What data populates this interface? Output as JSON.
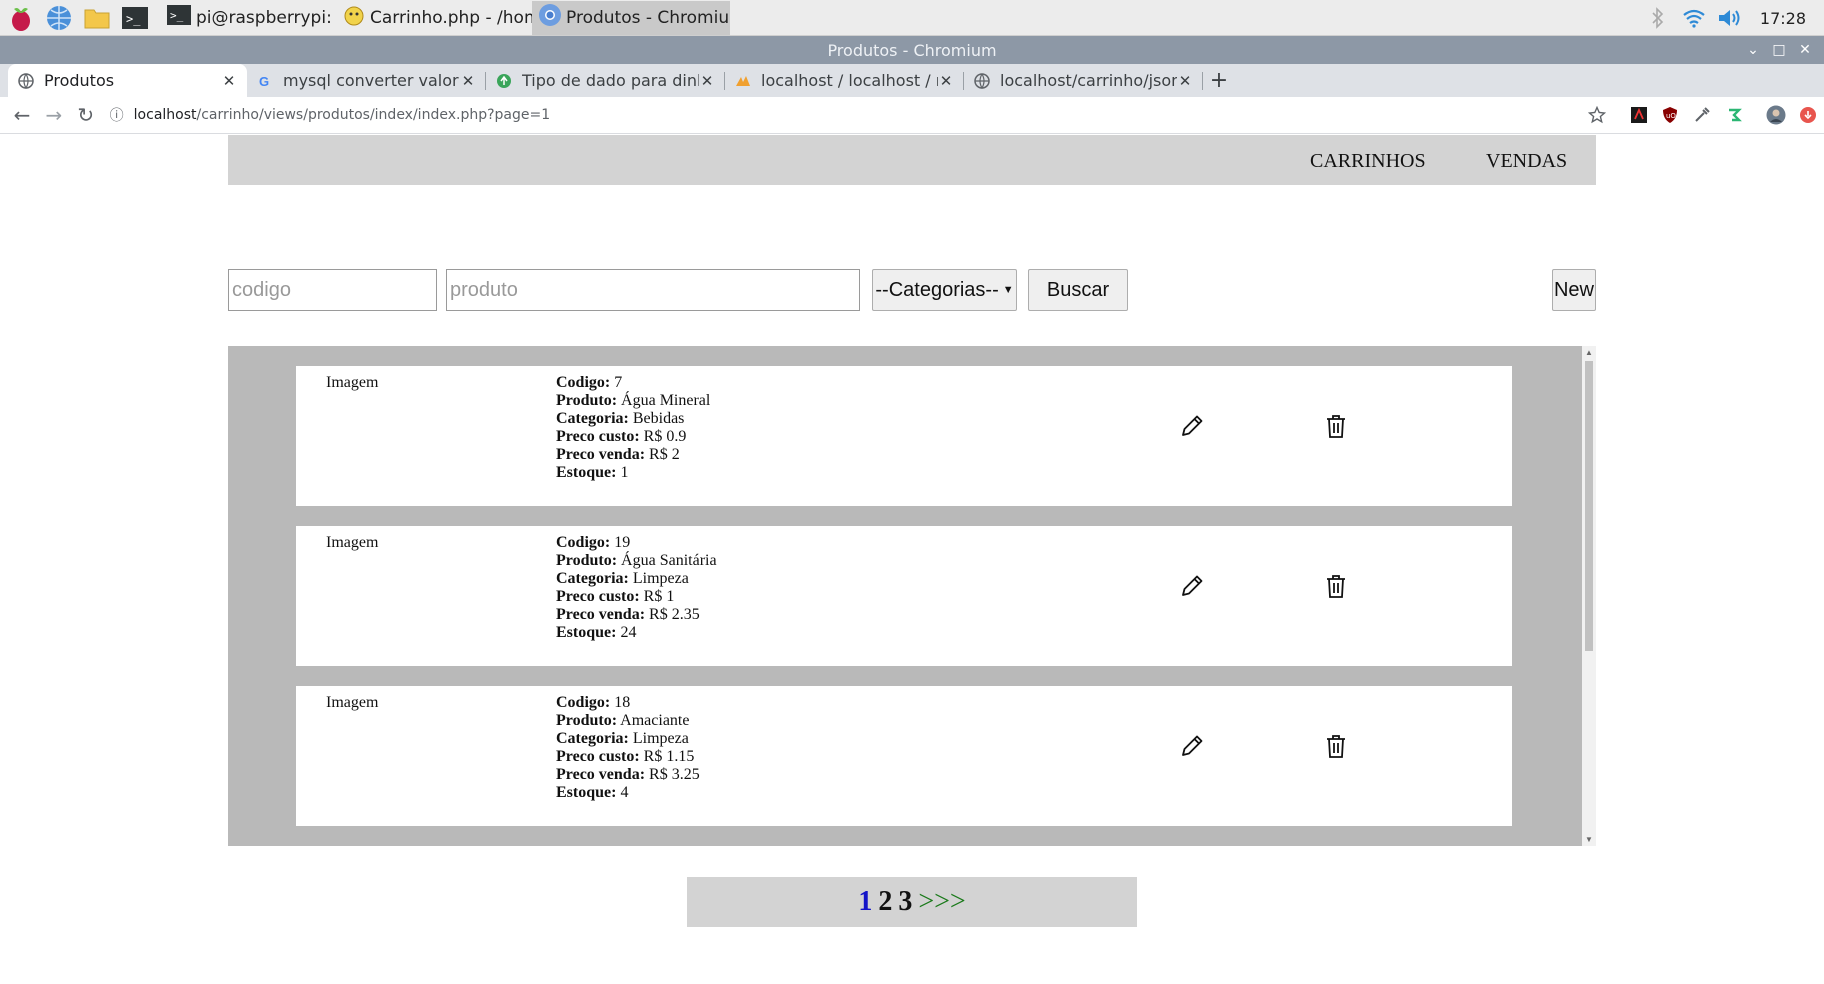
{
  "taskbar": {
    "tasks": [
      {
        "label": "pi@raspberrypi: ~/Do..."
      },
      {
        "label": "Carrinho.php - /home..."
      },
      {
        "label": "Produtos - Chromium"
      }
    ],
    "clock": "17:28"
  },
  "window": {
    "title": "Produtos - Chromium"
  },
  "tabs": [
    {
      "label": "Produtos"
    },
    {
      "label": "mysql converter valor em"
    },
    {
      "label": "Tipo de dado para dinheiro"
    },
    {
      "label": "localhost / localhost / my"
    },
    {
      "label": "localhost/carrinho/json/"
    }
  ],
  "omnibox": {
    "host": "localhost",
    "path": "/carrinho/views/produtos/index/index.php?page=1"
  },
  "nav": {
    "carrinhos": "CARRINHOS",
    "vendas": "VENDAS"
  },
  "search": {
    "codigo_placeholder": "codigo",
    "produto_placeholder": "produto",
    "categoria_selected": "--Categorias--",
    "buscar_label": "Buscar",
    "new_label": "New"
  },
  "labels": {
    "imagem": "Imagem",
    "codigo": "Codigo:",
    "produto": "Produto:",
    "categoria": "Categoria:",
    "preco_custo": "Preco custo:",
    "preco_venda": "Preco venda:",
    "estoque": "Estoque:"
  },
  "products": [
    {
      "codigo": "7",
      "produto": "Água Mineral",
      "categoria": "Bebidas",
      "preco_custo": "R$ 0.9",
      "preco_venda": "R$ 2",
      "estoque": "1"
    },
    {
      "codigo": "19",
      "produto": "Água Sanitária",
      "categoria": "Limpeza",
      "preco_custo": "R$ 1",
      "preco_venda": "R$ 2.35",
      "estoque": "24"
    },
    {
      "codigo": "18",
      "produto": "Amaciante",
      "categoria": "Limpeza",
      "preco_custo": "R$ 1.15",
      "preco_venda": "R$ 3.25",
      "estoque": "4"
    }
  ],
  "pagination": {
    "pages": [
      "1",
      "2",
      "3"
    ],
    "current": "1",
    "next": ">>>"
  },
  "colors": {
    "nav_bg": "#d3d3d3",
    "list_bg": "#b9b9b9",
    "current_page": "#1414c8",
    "next_link": "#1a7a1a"
  }
}
